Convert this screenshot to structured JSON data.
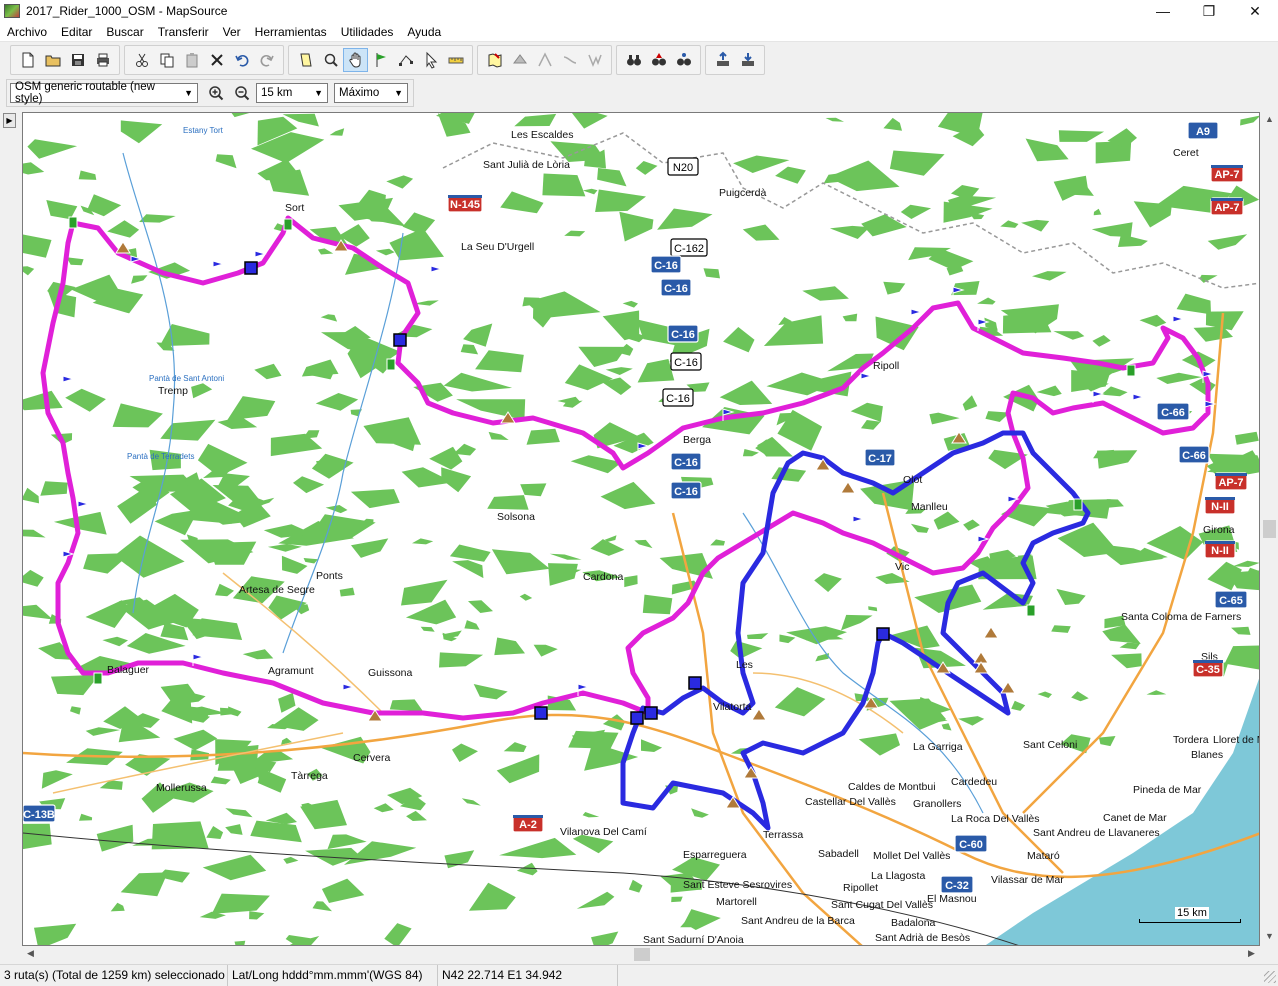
{
  "window": {
    "title": "2017_Rider_1000_OSM - MapSource",
    "controls": {
      "minimize": "—",
      "maximize": "❐",
      "close": "✕"
    }
  },
  "menu": {
    "items": [
      "Archivo",
      "Editar",
      "Buscar",
      "Transferir",
      "Ver",
      "Herramientas",
      "Utilidades",
      "Ayuda"
    ]
  },
  "toolbar2": {
    "map_product": "OSM generic routable (new style)",
    "zoom_scale": "15 km",
    "detail_level": "Máximo"
  },
  "map": {
    "places": [
      {
        "name": "Les Escaldes"
      },
      {
        "name": "Sant Julià de Lòria"
      },
      {
        "name": "Puigcerdà"
      },
      {
        "name": "Ceret"
      },
      {
        "name": "Sort"
      },
      {
        "name": "La Seu D'Urgell"
      },
      {
        "name": "Tremp"
      },
      {
        "name": "Solsona"
      },
      {
        "name": "Ponts"
      },
      {
        "name": "Artesa de Segre"
      },
      {
        "name": "Cardona"
      },
      {
        "name": "Manlleu"
      },
      {
        "name": "Vic"
      },
      {
        "name": "Girona"
      },
      {
        "name": "Santa Coloma de Farners"
      },
      {
        "name": "Sils"
      },
      {
        "name": "Agramunt"
      },
      {
        "name": "Guissona"
      },
      {
        "name": "Balaguer"
      },
      {
        "name": "Cervera"
      },
      {
        "name": "Tàrrega"
      },
      {
        "name": "Mollerussa"
      },
      {
        "name": "Vilanova Del Camí"
      },
      {
        "name": "Esparreguera"
      },
      {
        "name": "Terrassa"
      },
      {
        "name": "Sabadell"
      },
      {
        "name": "Castellar Del Vallès"
      },
      {
        "name": "Caldes de Montbui"
      },
      {
        "name": "Granollers"
      },
      {
        "name": "Cardedeu"
      },
      {
        "name": "La Garriga"
      },
      {
        "name": "Sant Celoni"
      },
      {
        "name": "Tordera"
      },
      {
        "name": "Blanes"
      },
      {
        "name": "Lloret de Mar"
      },
      {
        "name": "Pineda de Mar"
      },
      {
        "name": "Canet de Mar"
      },
      {
        "name": "Sant Andreu de Llavaneres"
      },
      {
        "name": "La Roca Del Vallès"
      },
      {
        "name": "Mataró"
      },
      {
        "name": "Vilassar de Mar"
      },
      {
        "name": "El Masnou"
      },
      {
        "name": "Mollet Del Vallès"
      },
      {
        "name": "La Llagosta"
      },
      {
        "name": "Ripollet"
      },
      {
        "name": "Sant Cugat Del Vallès"
      },
      {
        "name": "Sant Esteve Sesrovires"
      },
      {
        "name": "Martorell"
      },
      {
        "name": "Sant Andreu de la Barca"
      },
      {
        "name": "Badalona"
      },
      {
        "name": "Sant Adrià de Besòs"
      },
      {
        "name": "Sant Sadurní D'Anoia"
      },
      {
        "name": "Vilatorta"
      },
      {
        "name": "Les"
      },
      {
        "name": "Ripoll"
      },
      {
        "name": "Berga"
      },
      {
        "name": "Olot"
      }
    ],
    "water_labels": [
      {
        "name": "Estany Tort"
      },
      {
        "name": "Pantà de Sant Antoni"
      },
      {
        "name": "Pantà de Terradets"
      }
    ],
    "road_shields": [
      {
        "label": "N20"
      },
      {
        "label": "N-145"
      },
      {
        "label": "C-162"
      },
      {
        "label": "C-16"
      },
      {
        "label": "C-17"
      },
      {
        "label": "C-66"
      },
      {
        "label": "A9"
      },
      {
        "label": "AP-7"
      },
      {
        "label": "N-II"
      },
      {
        "label": "C-65"
      },
      {
        "label": "C-35"
      },
      {
        "label": "A-2"
      },
      {
        "label": "C-13B"
      },
      {
        "label": "C-60"
      },
      {
        "label": "C-32"
      }
    ],
    "scale_label": "15 km"
  },
  "status": {
    "selection": "3 ruta(s) (Total de 1259 km) seleccionado",
    "format": "Lat/Long hddd°mm.mmm'(WGS 84)",
    "coords": "N42 22.714 E1 34.942"
  },
  "colors": {
    "route_magenta": "#e020d8",
    "route_blue": "#2a2ae0",
    "forest": "#6cc45a",
    "sea": "#7ec8d8",
    "road_orange": "#f2a540",
    "shield_red": "#c8302a",
    "shield_blue": "#2a5aa8"
  }
}
